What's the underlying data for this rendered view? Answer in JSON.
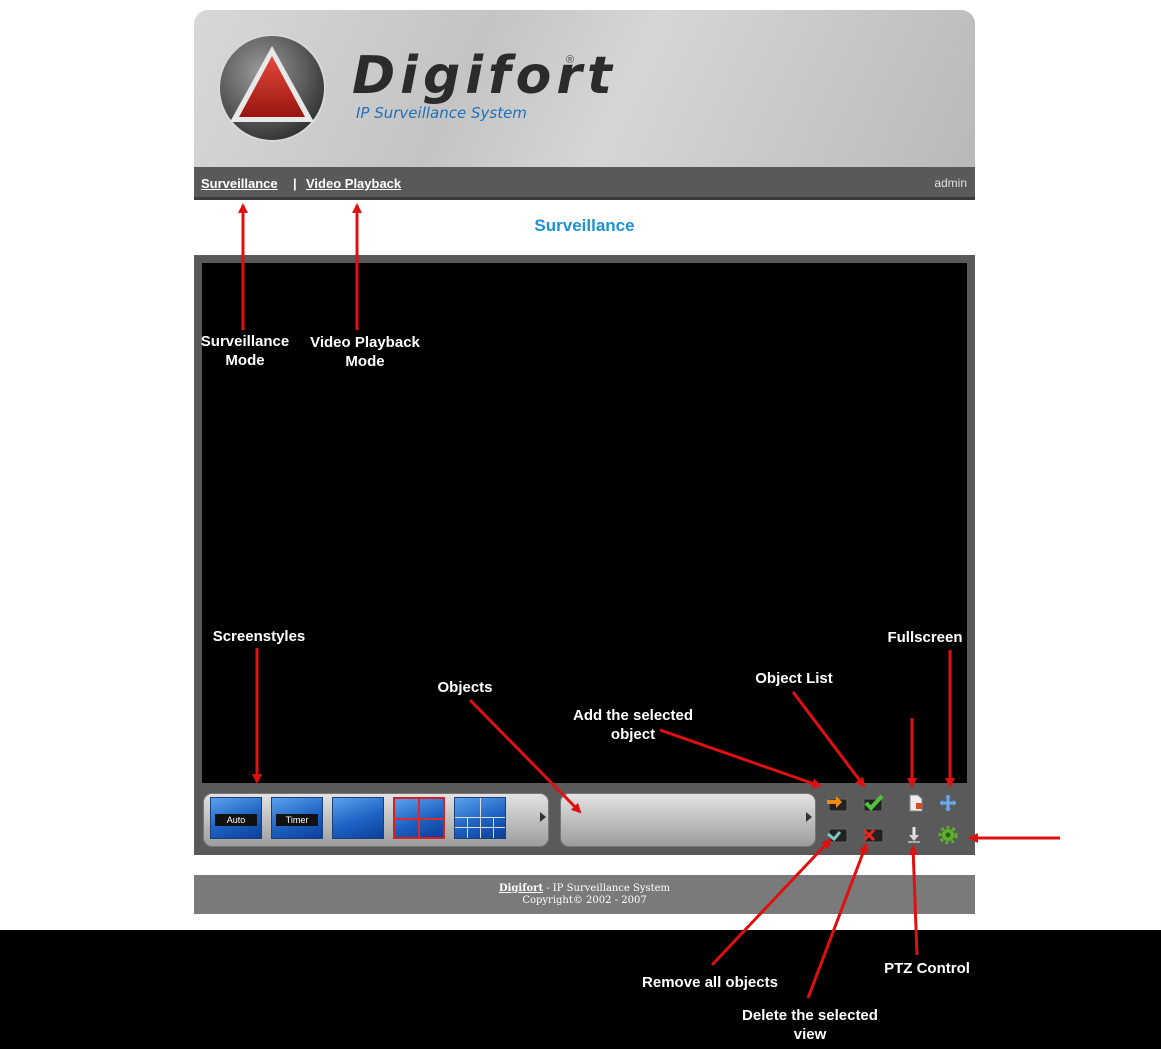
{
  "app": {
    "brand": "Digifort",
    "tagline": "IP Surveillance System"
  },
  "nav": {
    "surveillance": "Surveillance",
    "separator": "|",
    "playback": "Video Playback",
    "user": "admin"
  },
  "page_title": "Surveillance",
  "screen_styles": [
    {
      "label": "Auto"
    },
    {
      "label": "Timer"
    }
  ],
  "toolbar_icons": [
    "add-object-icon",
    "object-list-icon",
    "remove-all-icon",
    "delete-view-icon",
    "page-icon",
    "fullscreen-icon",
    "ptz-control-icon",
    "settings-gear-icon"
  ],
  "footer": {
    "brand": "Digifort",
    "line1_rest": " - IP Surveillance System",
    "line2": "Copyright© 2002 - 2007"
  },
  "annotations": {
    "surveillance_mode": [
      "Surveillance",
      "Mode"
    ],
    "playback_mode": [
      "Video Playback",
      "Mode"
    ],
    "screenstyles": "Screenstyles",
    "objects": "Objects",
    "add_selected": [
      "Add the selected",
      "object"
    ],
    "object_list": "Object List",
    "fullscreen": "Fullscreen",
    "remove_all": "Remove all objects",
    "delete_view": [
      "Delete the selected",
      "view"
    ],
    "ptz_control": "PTZ Control"
  },
  "colors": {
    "accent_blue": "#1e90d6",
    "annotation_red": "#e01010",
    "viewer_bg": "#000000"
  }
}
